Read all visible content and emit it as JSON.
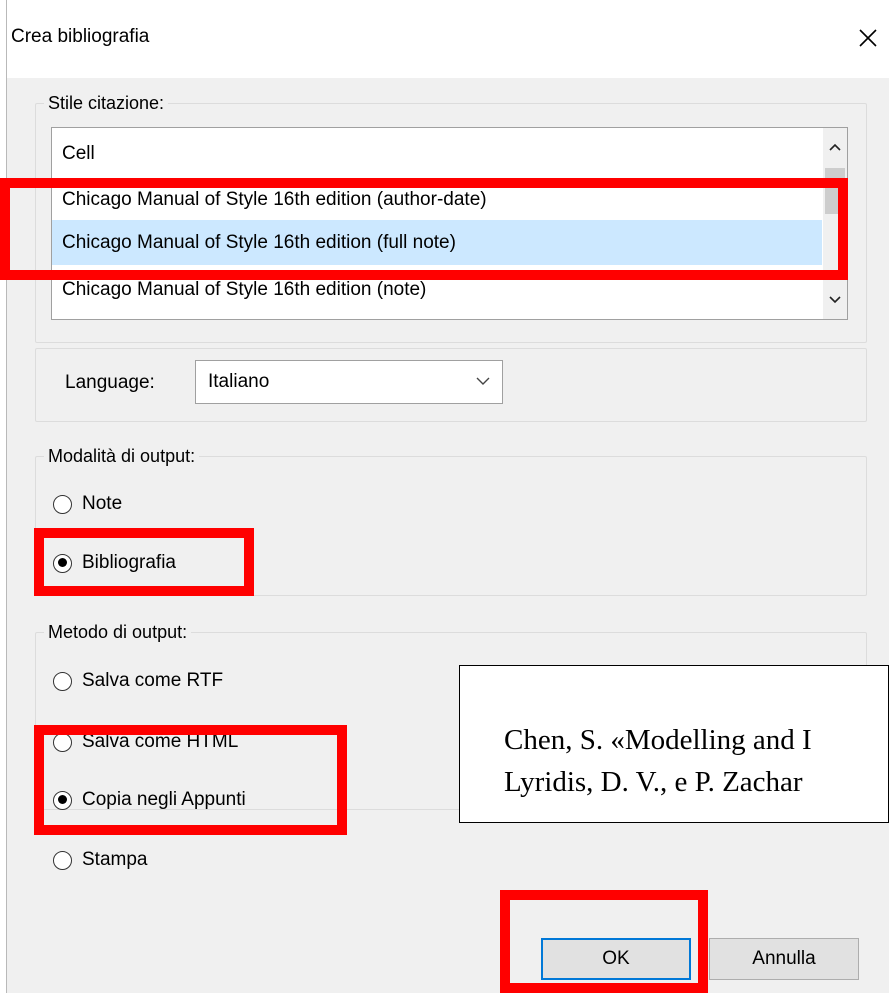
{
  "dialog": {
    "title": "Crea bibliografia",
    "close_icon": "close-x-icon"
  },
  "style_group": {
    "label": "Stile citazione:",
    "items": [
      {
        "label": "Cell"
      },
      {
        "label": "Chicago Manual of Style 16th edition (author-date)"
      },
      {
        "label": "Chicago Manual of Style 16th edition (full note)",
        "selected": true
      },
      {
        "label": "Chicago Manual of Style 16th edition (note)"
      }
    ]
  },
  "language": {
    "label": "Language:",
    "value": "Italiano"
  },
  "output_mode": {
    "label": "Modalità di output:",
    "options": [
      {
        "label": "Note",
        "checked": false
      },
      {
        "label": "Bibliografia",
        "checked": true
      }
    ]
  },
  "output_method": {
    "label": "Metodo di output:",
    "options": [
      {
        "label": "Salva come RTF",
        "checked": false
      },
      {
        "label": "Salva come HTML",
        "checked": false
      },
      {
        "label": "Copia negli Appunti",
        "checked": true
      },
      {
        "label": "Stampa",
        "checked": false
      }
    ]
  },
  "buttons": {
    "ok": "OK",
    "cancel": "Annulla"
  },
  "preview": {
    "line1": "Chen, S. «Modelling and I",
    "line2": "Lyridis, D. V., e P. Zachar"
  },
  "colors": {
    "highlight": "#ff0000",
    "selection": "#cce8ff",
    "dialog_bg": "#f0f0f0",
    "default_button_border": "#0078d7"
  }
}
